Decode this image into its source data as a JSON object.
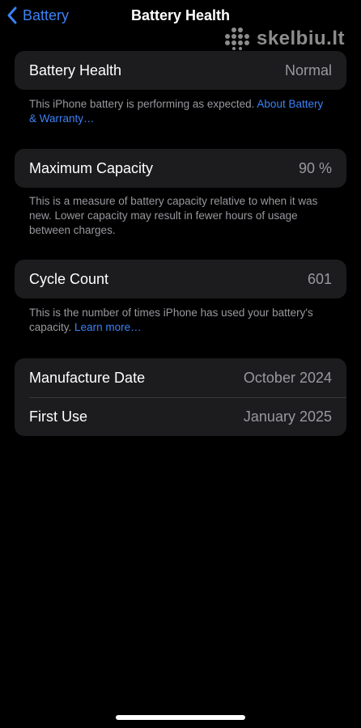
{
  "nav": {
    "back_label": "Battery",
    "title": "Battery Health"
  },
  "watermark": {
    "text": "skelbiu.lt"
  },
  "health": {
    "label": "Battery Health",
    "value": "Normal",
    "note": "This iPhone battery is performing as expected.",
    "link": "About Battery & Warranty…"
  },
  "capacity": {
    "label": "Maximum Capacity",
    "value": "90 %",
    "note": "This is a measure of battery capacity relative to when it was new. Lower capacity may result in fewer hours of usage between charges."
  },
  "cycles": {
    "label": "Cycle Count",
    "value": "601",
    "note": "This is the number of times iPhone has used your battery's capacity.",
    "link": "Learn more…"
  },
  "dates": {
    "manufacture_label": "Manufacture Date",
    "manufacture_value": "October 2024",
    "first_use_label": "First Use",
    "first_use_value": "January 2025"
  },
  "colors": {
    "accent": "#3b82f6",
    "background": "#000000",
    "card": "#1c1c1e",
    "secondary_text": "#98989f"
  }
}
